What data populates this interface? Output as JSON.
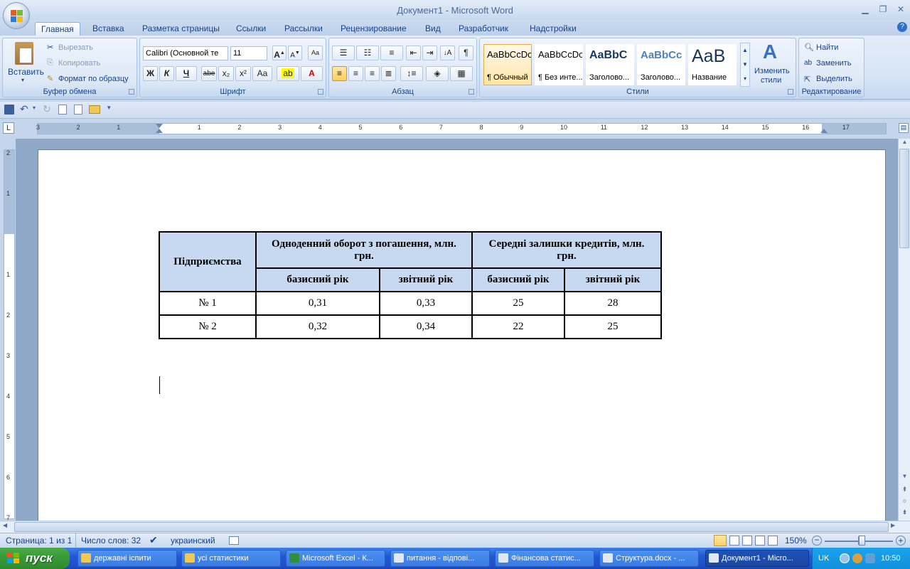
{
  "window": {
    "title": "Документ1 - Microsoft Word"
  },
  "tabs": [
    "Главная",
    "Вставка",
    "Разметка страницы",
    "Ссылки",
    "Рассылки",
    "Рецензирование",
    "Вид",
    "Разработчик",
    "Надстройки"
  ],
  "ribbon": {
    "clipboard": {
      "label": "Буфер обмена",
      "paste": "Вставить",
      "cut": "Вырезать",
      "copy": "Копировать",
      "format_painter": "Формат по образцу"
    },
    "font": {
      "label": "Шрифт",
      "font_name": "Calibri (Основной те",
      "font_size": "11",
      "bold": "Ж",
      "italic": "К",
      "underline": "Ч",
      "strike": "abe",
      "subscript": "x₂",
      "superscript": "x²",
      "change_case": "Aa"
    },
    "paragraph": {
      "label": "Абзац",
      "pilcrow": "¶"
    },
    "styles": {
      "label": "Стили",
      "items": [
        {
          "sample": "AaBbCcDc",
          "name": "¶ Обычный"
        },
        {
          "sample": "AaBbCcDc",
          "name": "¶ Без инте..."
        },
        {
          "sample": "AaBbC",
          "name": "Заголово..."
        },
        {
          "sample": "AaBbCc",
          "name": "Заголово..."
        },
        {
          "sample": "AaB",
          "name": "Название"
        }
      ],
      "change_line1": "Изменить",
      "change_line2": "стили"
    },
    "editing": {
      "label": "Редактирование",
      "find": "Найти",
      "replace": "Заменить",
      "select": "Выделить"
    }
  },
  "ruler": {
    "numbers": [
      "3",
      "2",
      "1",
      "1",
      "2",
      "3",
      "4",
      "5",
      "6",
      "7",
      "8",
      "9",
      "10",
      "11",
      "12",
      "13",
      "14",
      "15",
      "16",
      "17"
    ]
  },
  "vruler": {
    "numbers": [
      "2",
      "1",
      "1",
      "2",
      "3",
      "4",
      "5",
      "6",
      "7"
    ]
  },
  "document": {
    "table": {
      "h_company": "Підприємства",
      "h_group1": "Одноденний оборот з погашення, млн. грн.",
      "h_group2": "Середні залишки кредитів, млн. грн.",
      "sub": [
        "базисний рік",
        "звітний рік",
        "базисний рік",
        "звітний рік"
      ],
      "rows": [
        [
          "№ 1",
          "0,31",
          "0,33",
          "25",
          "28"
        ],
        [
          "№ 2",
          "0,32",
          "0,34",
          "22",
          "25"
        ]
      ]
    }
  },
  "status": {
    "page": "Страница: 1 из 1",
    "words": "Число слов: 32",
    "language": "украинский",
    "zoom": "150%"
  },
  "taskbar": {
    "start": "пуск",
    "tasks": [
      "державні іспити",
      "усі статистики",
      "Microsoft Excel - К...",
      "питання - відпові...",
      "Фінансова статис...",
      "Структура.docx - ...",
      "Документ1 - Micro..."
    ],
    "lang": "UK",
    "clock": "10:50"
  },
  "colors": {
    "table_header": "#c6d9f1",
    "ribbon_text": "#15428b",
    "taskbar": "#2357d3",
    "start": "#379a37"
  }
}
